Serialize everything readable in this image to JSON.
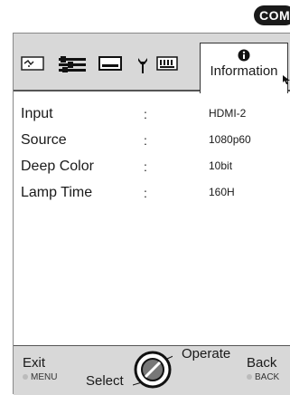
{
  "badge": "COM",
  "tabs": [
    {
      "icon": "picture-icon"
    },
    {
      "icon": "adjust-sliders-icon"
    },
    {
      "icon": "screen-icon"
    },
    {
      "icon": "setup-tool-icon"
    },
    {
      "icon": "connector-icon"
    }
  ],
  "active_tab": {
    "icon": "info-icon",
    "label": "Information"
  },
  "info_rows": [
    {
      "label": "Input",
      "sep": ":",
      "value": "HDMI-2"
    },
    {
      "label": "Source",
      "sep": ":",
      "value": "1080p60"
    },
    {
      "label": "Deep Color",
      "sep": ":",
      "value": "10bit"
    },
    {
      "label": "Lamp Time",
      "sep": ":",
      "value": "160H"
    }
  ],
  "footer": {
    "exit": "Exit",
    "menu": "MENU",
    "select": "Select",
    "operate": "Operate",
    "back": "Back",
    "back_sub": "BACK"
  }
}
